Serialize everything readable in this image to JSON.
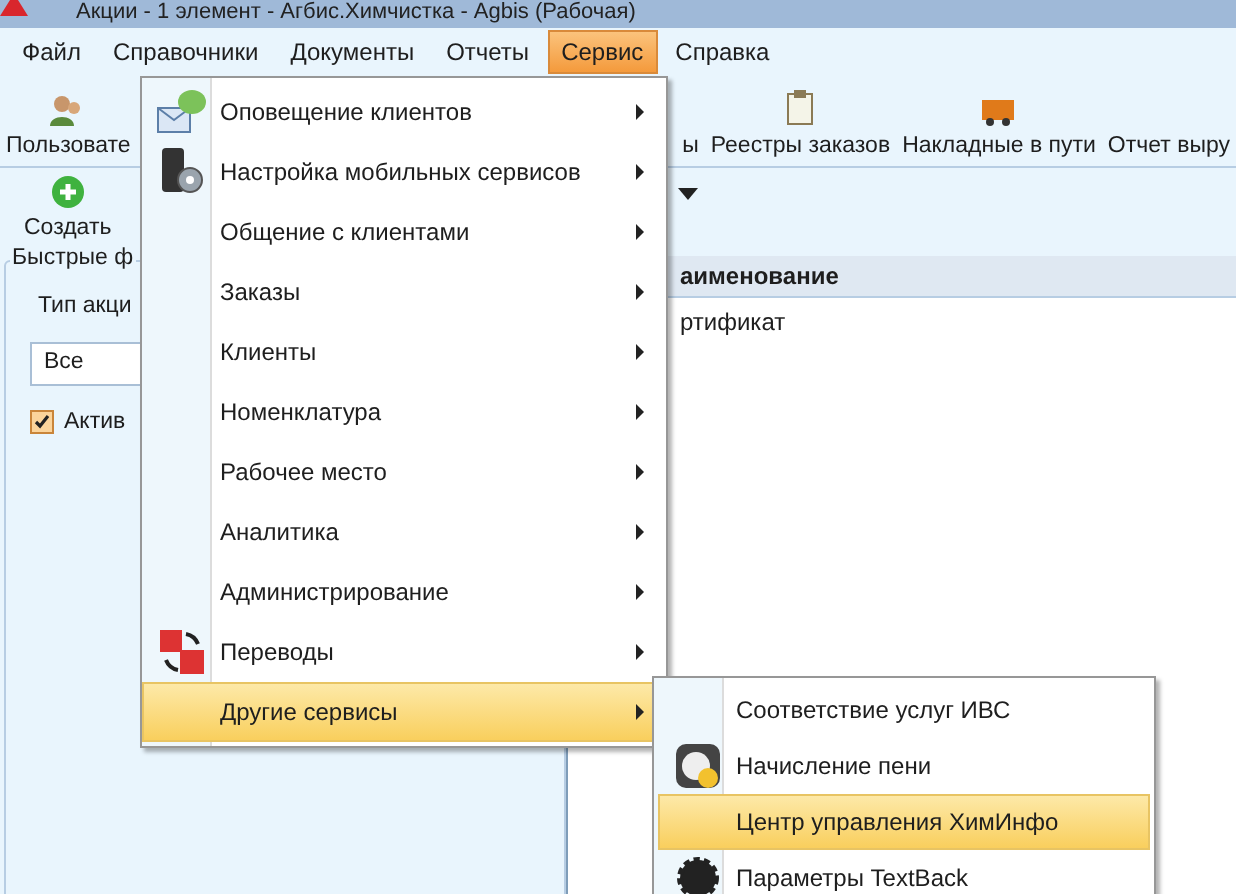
{
  "window": {
    "title": "Акции - 1 элемент - Агбис.Химчистка - Agbis (Рабочая)"
  },
  "menu_bar": [
    {
      "label": "Файл",
      "selected": false
    },
    {
      "label": "Справочники",
      "selected": false
    },
    {
      "label": "Документы",
      "selected": false
    },
    {
      "label": "Отчеты",
      "selected": false
    },
    {
      "label": "Сервис",
      "selected": true
    },
    {
      "label": "Справка",
      "selected": false
    }
  ],
  "toolbar": {
    "left_items": [
      "Пользовате"
    ],
    "right_items": [
      "ы",
      "Реестры заказов",
      "Накладные в пути",
      "Отчет выру"
    ]
  },
  "actions": {
    "create": "Создать"
  },
  "quick_filters": {
    "title": "Быстрые ф",
    "type_label": "Тип акци",
    "type_value": "Все",
    "active_label": "Актив",
    "active_checked": true
  },
  "grid": {
    "column_header": "аименование",
    "rows": [
      "ртификат"
    ]
  },
  "service_menu": [
    {
      "label": "Оповещение клиентов",
      "selected": false
    },
    {
      "label": "Настройка мобильных сервисов",
      "selected": false
    },
    {
      "label": "Общение с клиентами",
      "selected": false
    },
    {
      "label": "Заказы",
      "selected": false
    },
    {
      "label": "Клиенты",
      "selected": false
    },
    {
      "label": "Номенклатура",
      "selected": false
    },
    {
      "label": "Рабочее место",
      "selected": false
    },
    {
      "label": "Аналитика",
      "selected": false
    },
    {
      "label": "Администрирование",
      "selected": false
    },
    {
      "label": "Переводы",
      "selected": false
    },
    {
      "label": "Другие сервисы",
      "selected": true
    }
  ],
  "other_services_submenu": [
    {
      "label": "Соответствие услуг ИВС",
      "selected": false
    },
    {
      "label": "Начисление пени",
      "selected": false
    },
    {
      "label": "Центр управления ХимИнфо",
      "selected": true
    },
    {
      "label": "Параметры TextBack",
      "selected": false
    }
  ]
}
